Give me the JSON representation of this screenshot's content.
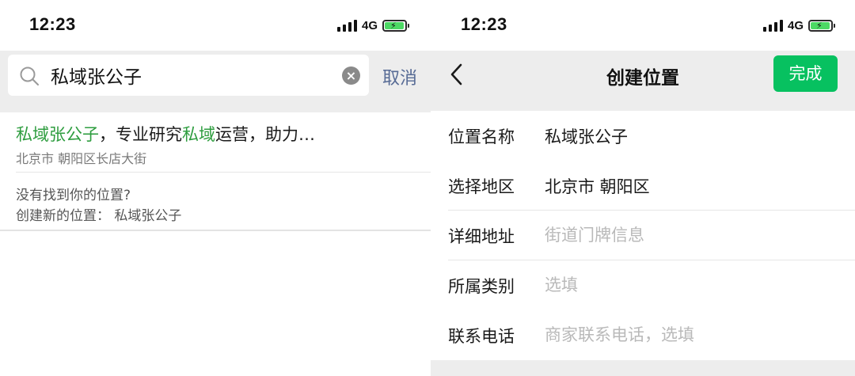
{
  "left": {
    "status": {
      "time": "12:23",
      "network": "4G"
    },
    "search": {
      "query": "私域张公子",
      "cancel_label": "取消"
    },
    "result": {
      "title_parts": [
        "私域张公子",
        "，专业研究",
        "私域",
        "运营，助力…"
      ],
      "address": "北京市 朝阳区长店大街"
    },
    "create": {
      "hint": "没有找到你的位置?",
      "link": "创建新的位置：  私域张公子"
    }
  },
  "right": {
    "status": {
      "time": "12:23",
      "network": "4G"
    },
    "nav": {
      "title": "创建位置",
      "done_label": "完成"
    },
    "form": {
      "name_label": "位置名称",
      "name_value": "私域张公子",
      "region_label": "选择地区",
      "region_value": "北京市 朝阳区",
      "address_label": "详细地址",
      "address_placeholder": "街道门牌信息",
      "category_label": "所属类别",
      "category_placeholder": "选填",
      "phone_label": "联系电话",
      "phone_placeholder": "商家联系电话，选填"
    }
  },
  "icons": {
    "search": "search-icon",
    "clear": "clear-icon",
    "back": "back-chevron-icon",
    "signal": "signal-icon",
    "battery": "battery-charging-icon"
  },
  "colors": {
    "highlight": "#2e9d3f",
    "link_blue": "#576b95",
    "done_green": "#07c160",
    "bar_background": "#ededed",
    "battery_green": "#4cd964"
  }
}
